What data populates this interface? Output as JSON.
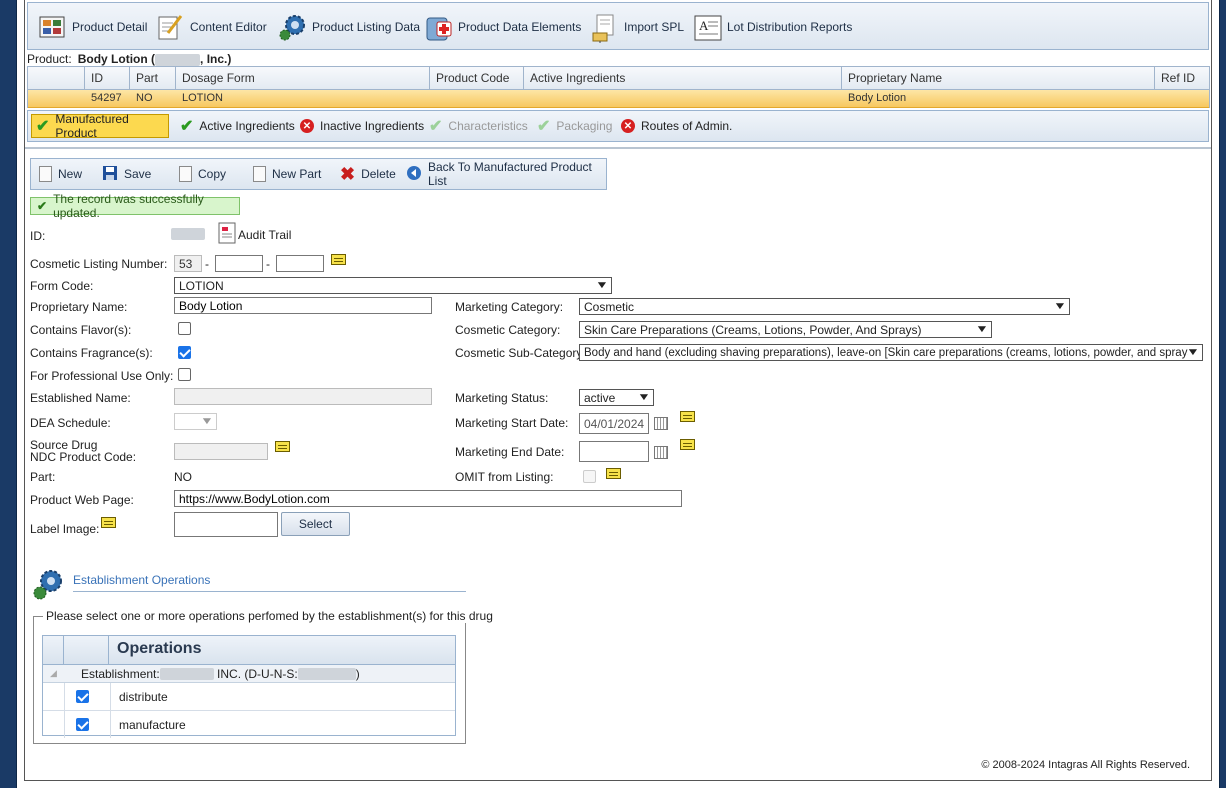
{
  "toolbar": {
    "product_detail": "Product Detail",
    "content_editor": "Content Editor",
    "product_listing_data": "Product Listing Data",
    "product_data_elements": "Product Data Elements",
    "import_spl": "Import SPL",
    "lot_distribution_reports": "Lot Distribution Reports"
  },
  "product": {
    "label": "Product:",
    "name_start": "Body Lotion (",
    "name_end": ", Inc.)"
  },
  "grid": {
    "headers": [
      "ID",
      "Part",
      "Dosage Form",
      "Product Code",
      "Active Ingredients",
      "Proprietary Name",
      "Ref ID"
    ],
    "row": {
      "id": "54297",
      "part": "NO",
      "dosage_form": "LOTION",
      "product_code": "",
      "active_ingredients": "",
      "proprietary_name": "Body Lotion",
      "ref_id": ""
    }
  },
  "tabs": {
    "manufactured_product": "Manufactured Product",
    "active_ingredients": "Active Ingredients",
    "inactive_ingredients": "Inactive Ingredients",
    "characteristics": "Characteristics",
    "packaging": "Packaging",
    "routes_of_admin": "Routes of Admin."
  },
  "actions": {
    "new": "New",
    "save": "Save",
    "copy": "Copy",
    "new_part": "New Part",
    "delete": "Delete",
    "back": "Back To Manufactured Product List"
  },
  "message": "The record was successfully updated.",
  "form": {
    "id_label": "ID:",
    "audit_trail": "Audit Trail",
    "cosmetic_listing_number_label": "Cosmetic Listing Number:",
    "cln_part1": "53",
    "cln_dash": "-",
    "form_code_label": "Form Code:",
    "form_code_value": "LOTION",
    "proprietary_name_label": "Proprietary Name:",
    "proprietary_name_value": "Body Lotion",
    "contains_flavor_label": "Contains Flavor(s):",
    "contains_fragrance_label": "Contains Fragrance(s):",
    "professional_use_label": "For Professional Use Only:",
    "established_name_label": "Established Name:",
    "dea_schedule_label": "DEA Schedule:",
    "source_drug_label1": "Source Drug",
    "source_drug_label2": "NDC Product Code:",
    "part_label": "Part:",
    "part_value": "NO",
    "web_page_label": "Product Web Page:",
    "web_page_value": "https://www.BodyLotion.com",
    "label_image_label": "Label Image:",
    "select_button": "Select",
    "marketing_category_label": "Marketing Category:",
    "marketing_category_value": "Cosmetic",
    "cosmetic_category_label": "Cosmetic Category:",
    "cosmetic_category_value": "Skin Care Preparations (Creams, Lotions, Powder, And Sprays)",
    "cosmetic_subcategory_label": "Cosmetic Sub-Category:",
    "cosmetic_subcategory_value": "Body and hand (excluding shaving preparations), leave-on [Skin care preparations (creams, lotions, powder, and sprays)]",
    "marketing_status_label": "Marketing Status:",
    "marketing_status_value": "active",
    "marketing_start_label": "Marketing Start Date:",
    "marketing_start_value": "04/01/2024",
    "marketing_end_label": "Marketing End Date:",
    "omit_label": "OMIT from Listing:",
    "contains_flavor": false,
    "contains_fragrance": true,
    "professional_use": false
  },
  "establishment": {
    "title": "Establishment Operations",
    "legend": "Please select one or more operations perfomed by the establishment(s) for this drug",
    "column": "Operations",
    "group_prefix": "Establishment: ",
    "group_mid": "INC. (D-U-N-S:",
    "group_end": ")",
    "operations": [
      {
        "label": "distribute",
        "checked": true
      },
      {
        "label": "manufacture",
        "checked": true
      }
    ]
  },
  "footer": "© 2008-2024 Intagras All Rights Reserved."
}
